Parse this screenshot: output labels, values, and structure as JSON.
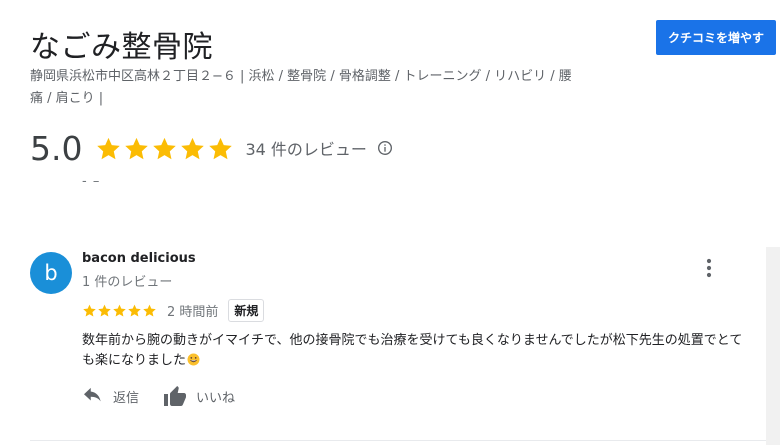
{
  "business": {
    "name": "なごみ整骨院",
    "address_line": "静岡県浜松市中区高林２丁目２−６ | 浜松 / 整骨院 / 骨格調整 / トレーニング / リハビリ / 腰痛 / 肩こり |",
    "cta_label": "クチコミを増やす"
  },
  "rating": {
    "score": "5.0",
    "stars": 5,
    "review_count": "34 件のレビュー",
    "star_color": "#fbbc04"
  },
  "dash_text": "- –",
  "review": {
    "avatar_letter": "b",
    "avatar_color": "#1a8fd8",
    "reviewer_name": "bacon delicious",
    "reviewer_sub": "1 件のレビュー",
    "stars": 5,
    "time": "2 時間前",
    "badge": "新規",
    "text": "数年前から腕の動きがイマイチで、他の接骨院でも治療を受けても良くなりませんでしたが松下先生の処置でとても楽になりました",
    "reply_label": "返信",
    "like_label": "いいね"
  },
  "colors": {
    "primary_button": "#1a73e8",
    "text_secondary": "#5f6368"
  }
}
